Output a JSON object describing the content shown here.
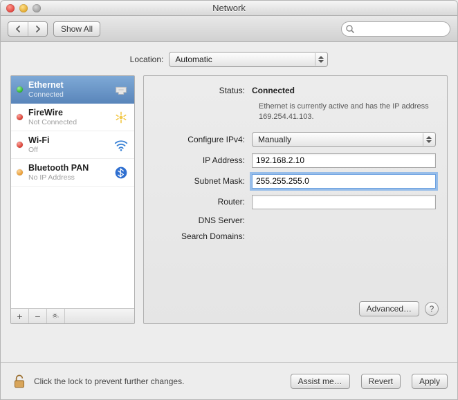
{
  "window": {
    "title": "Network"
  },
  "toolbar": {
    "show_all_label": "Show All",
    "search_placeholder": ""
  },
  "location": {
    "label": "Location:",
    "selected": "Automatic"
  },
  "sidebar": {
    "items": [
      {
        "name": "Ethernet",
        "sub": "Connected",
        "status": "green",
        "icon": "ethernet",
        "selected": true
      },
      {
        "name": "FireWire",
        "sub": "Not Connected",
        "status": "red",
        "icon": "firewire",
        "selected": false
      },
      {
        "name": "Wi-Fi",
        "sub": "Off",
        "status": "red",
        "icon": "wifi",
        "selected": false
      },
      {
        "name": "Bluetooth PAN",
        "sub": "No IP Address",
        "status": "orange",
        "icon": "bluetooth",
        "selected": false
      }
    ],
    "footer": {
      "add": "+",
      "remove": "−",
      "action": "✻▾"
    }
  },
  "detail": {
    "status_label": "Status:",
    "status_value": "Connected",
    "status_desc": "Ethernet is currently active and has the IP address 169.254.41.103.",
    "config_label": "Configure IPv4:",
    "config_value": "Manually",
    "ip_label": "IP Address:",
    "ip_value": "192.168.2.10",
    "mask_label": "Subnet Mask:",
    "mask_value": "255.255.255.0",
    "router_label": "Router:",
    "router_value": "",
    "dns_label": "DNS Server:",
    "search_label": "Search Domains:",
    "advanced_label": "Advanced…",
    "help_label": "?"
  },
  "bottom": {
    "lock_text": "Click the lock to prevent further changes.",
    "assist_label": "Assist me…",
    "revert_label": "Revert",
    "apply_label": "Apply"
  }
}
